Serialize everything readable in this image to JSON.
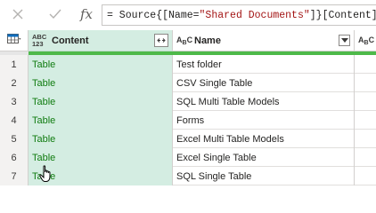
{
  "formula_bar": {
    "cancel_icon": "close-icon",
    "confirm_icon": "check-icon",
    "fx_label": "fx",
    "formula_prefix": "= Source{[Name=",
    "formula_string": "\"Shared Documents\"",
    "formula_suffix": "]}[Content]"
  },
  "grid": {
    "columns": [
      {
        "type_top": "ABC",
        "type_bottom": "123",
        "label": "Content"
      },
      {
        "type_top": "A",
        "type_sub": "B",
        "type_end": "C",
        "label": "Name"
      },
      {
        "type_top": "A",
        "type_sub": "B",
        "type_end": "C",
        "label": ""
      }
    ],
    "rows": [
      {
        "num": "1",
        "content": "Table",
        "name": "Test folder"
      },
      {
        "num": "2",
        "content": "Table",
        "name": "CSV Single Table"
      },
      {
        "num": "3",
        "content": "Table",
        "name": "SQL Multi Table Models"
      },
      {
        "num": "4",
        "content": "Table",
        "name": "Forms"
      },
      {
        "num": "5",
        "content": "Table",
        "name": "Excel Multi Table Models"
      },
      {
        "num": "6",
        "content": "Table",
        "name": "Excel Single Table"
      },
      {
        "num": "7",
        "content": "Table",
        "name": "SQL Single Table"
      }
    ]
  },
  "colors": {
    "selected_column_bg": "#d4ede2",
    "link_green": "#107c10",
    "quality_bar": "#13a10e"
  }
}
